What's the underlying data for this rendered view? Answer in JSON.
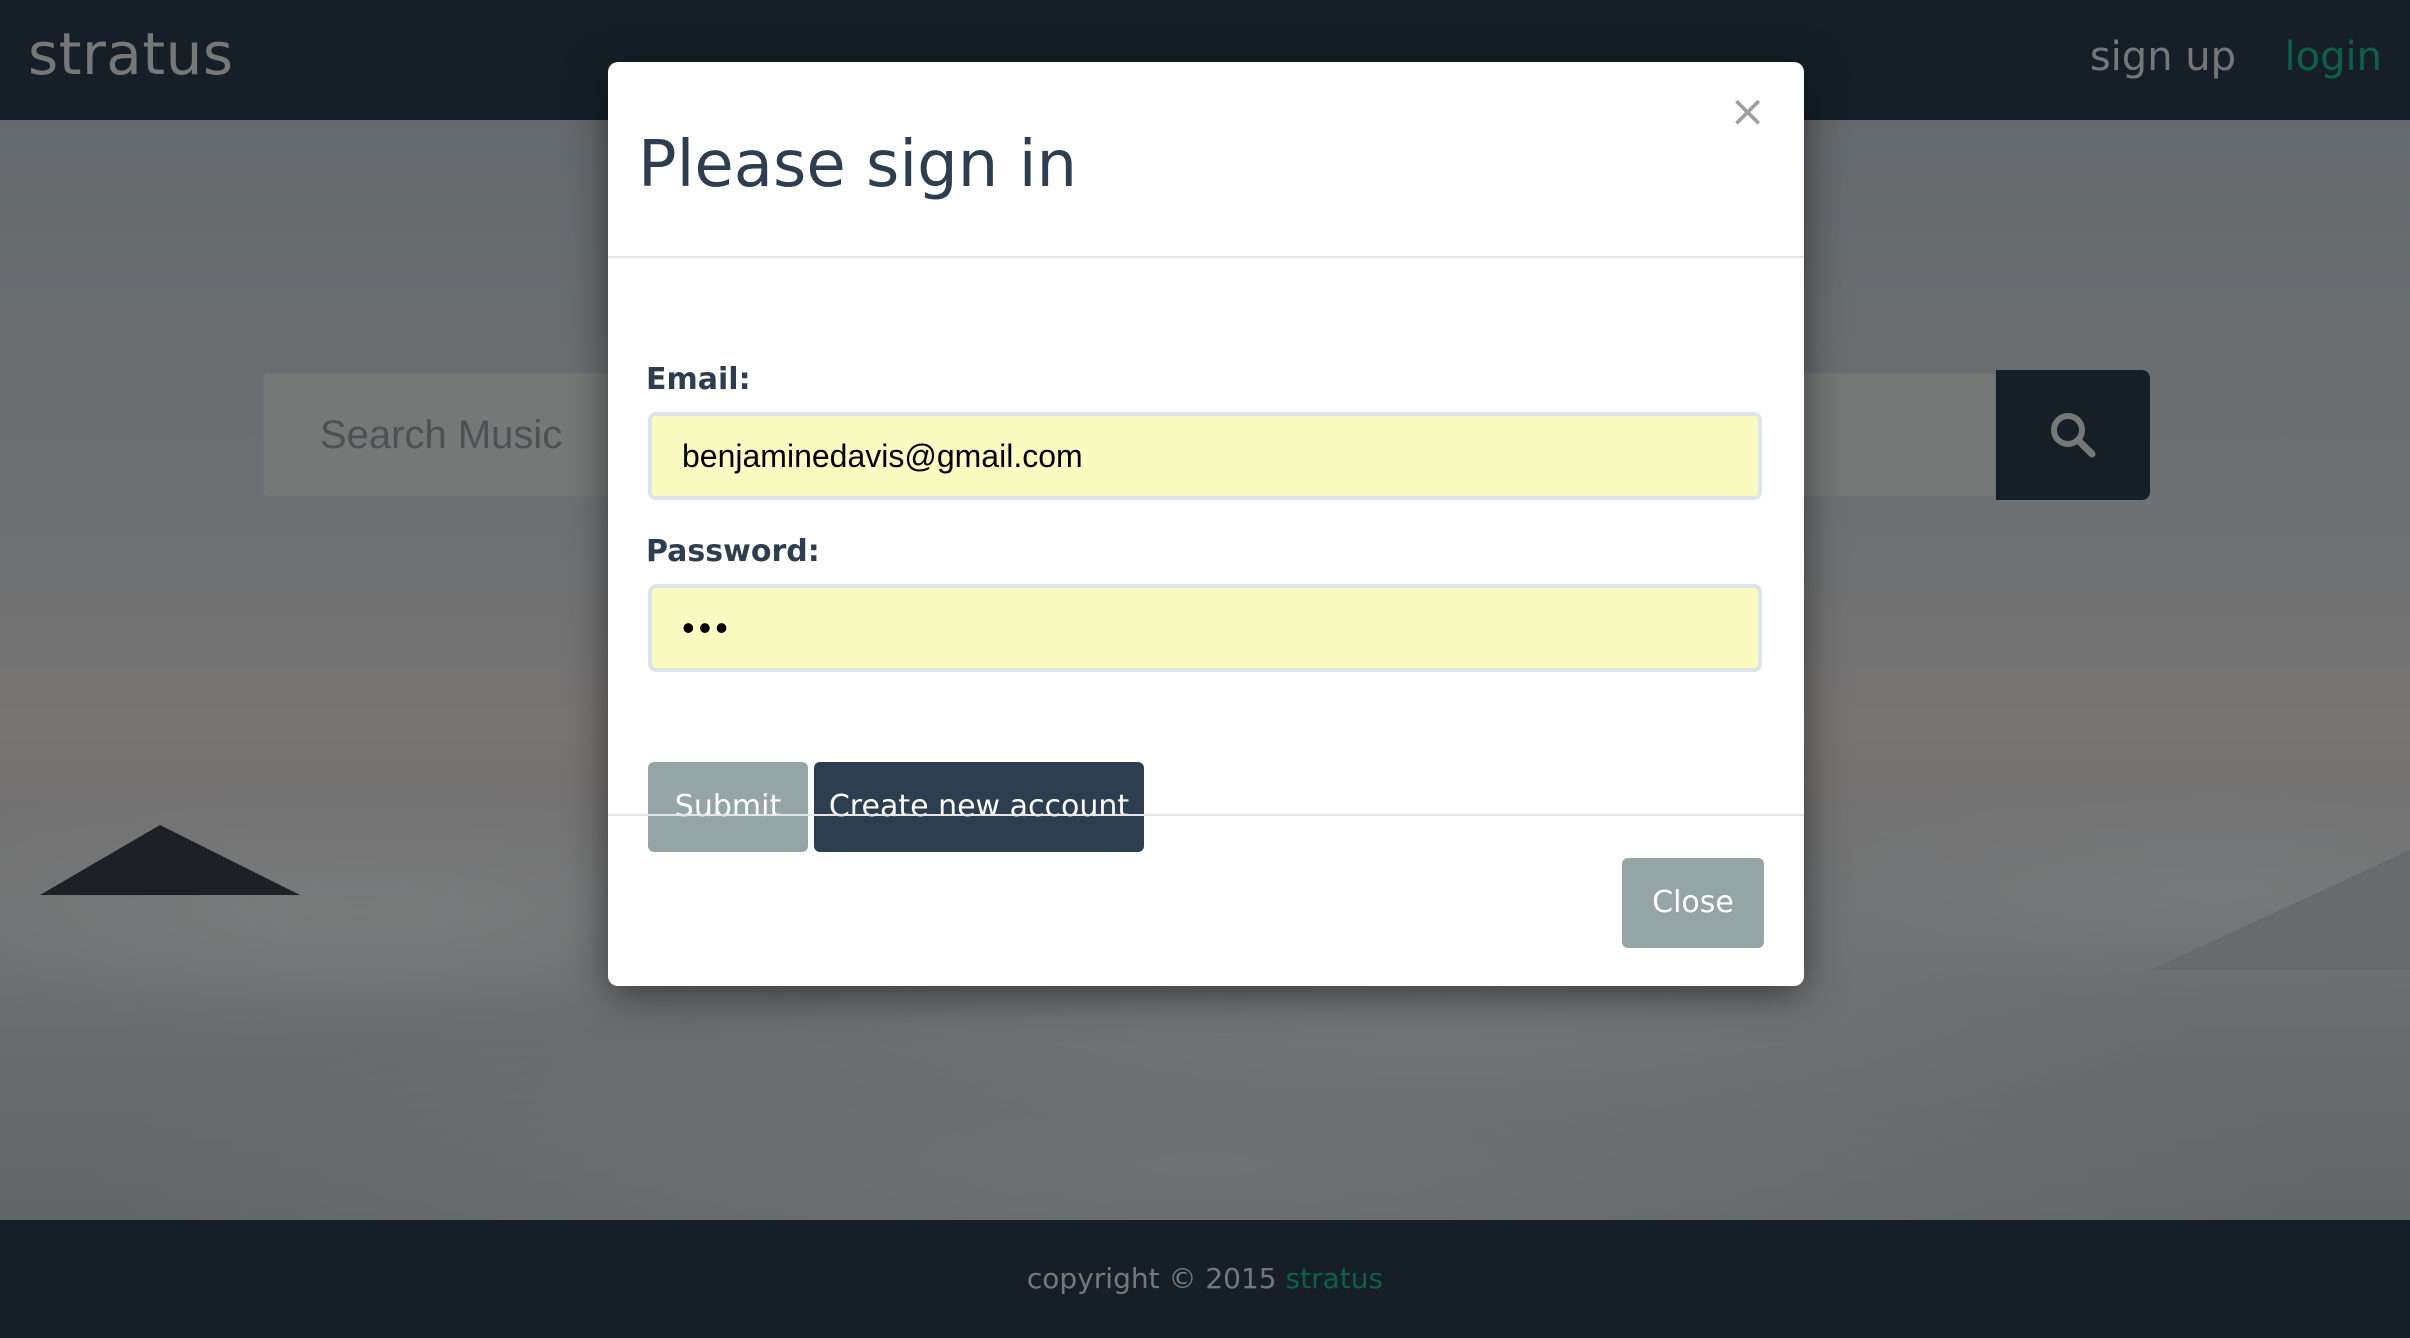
{
  "navbar": {
    "brand": "stratus",
    "signup_label": "sign up",
    "login_label": "login"
  },
  "search": {
    "placeholder": "Search Music",
    "icon": "search-icon"
  },
  "modal": {
    "title": "Please sign in",
    "close_icon": "×",
    "email_label": "Email:",
    "email_value": "benjaminedavis@gmail.com",
    "password_label": "Password:",
    "password_value": "•••",
    "submit_label": "Submit",
    "create_account_label": "Create new account",
    "close_label": "Close"
  },
  "footer": {
    "copyright_text": "copyright © 2015",
    "brand": "stratus"
  },
  "colors": {
    "primary": "#2c3e50",
    "accent": "#18bc9c",
    "muted": "#95a5a6",
    "autofill": "#fafbc0"
  }
}
